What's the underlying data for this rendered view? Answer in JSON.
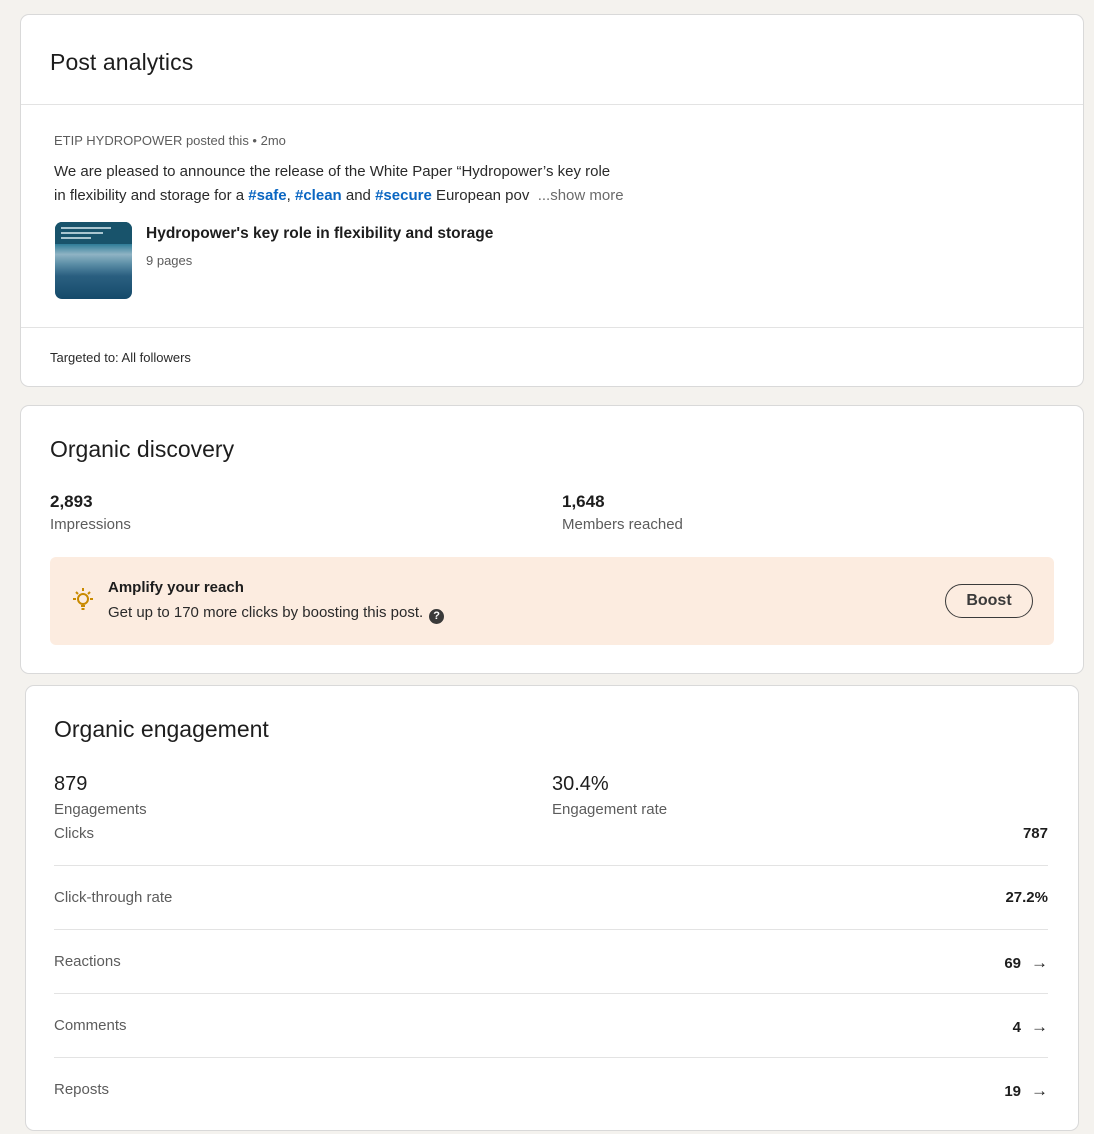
{
  "post_analytics": {
    "title": "Post analytics",
    "meta": "ETIP HYDROPOWER posted this • 2mo",
    "text_line1": "We are pleased to announce the release of the White Paper “Hydropower’s key role",
    "text_line2_prefix": "in flexibility and storage for a ",
    "tag_safe": "#safe",
    "sep1": ", ",
    "tag_clean": "#clean",
    "and_text": " and ",
    "tag_secure": "#secure",
    "text_line2_suffix": " European pov",
    "show_more": "  ...show more",
    "document": {
      "title": "Hydropower's key role in flexibility and storage",
      "pages": "9 pages"
    },
    "targeted": "Targeted to: All followers"
  },
  "organic_discovery": {
    "title": "Organic discovery",
    "impressions_value": "2,893",
    "impressions_label": "Impressions",
    "members_value": "1,648",
    "members_label": "Members reached",
    "promo": {
      "title": "Amplify your reach",
      "text": "Get up to 170 more clicks by boosting this post.",
      "help": "?",
      "button": "Boost"
    }
  },
  "organic_engagement": {
    "title": "Organic engagement",
    "engagements_value": "879",
    "engagements_label": "Engagements",
    "rate_value": "30.4%",
    "rate_label": "Engagement rate",
    "rows": [
      {
        "label": "Clicks",
        "value": "787",
        "arrow": ""
      },
      {
        "label": "Click-through rate",
        "value": "27.2%",
        "arrow": ""
      },
      {
        "label": "Reactions",
        "value": "69",
        "arrow": "→"
      },
      {
        "label": "Comments",
        "value": "4",
        "arrow": "→"
      },
      {
        "label": "Reposts",
        "value": "19",
        "arrow": "→"
      }
    ]
  },
  "colors": {
    "link": "#0a66c2",
    "promo_bg": "#fcece0",
    "page_bg": "#f4f2ee"
  }
}
